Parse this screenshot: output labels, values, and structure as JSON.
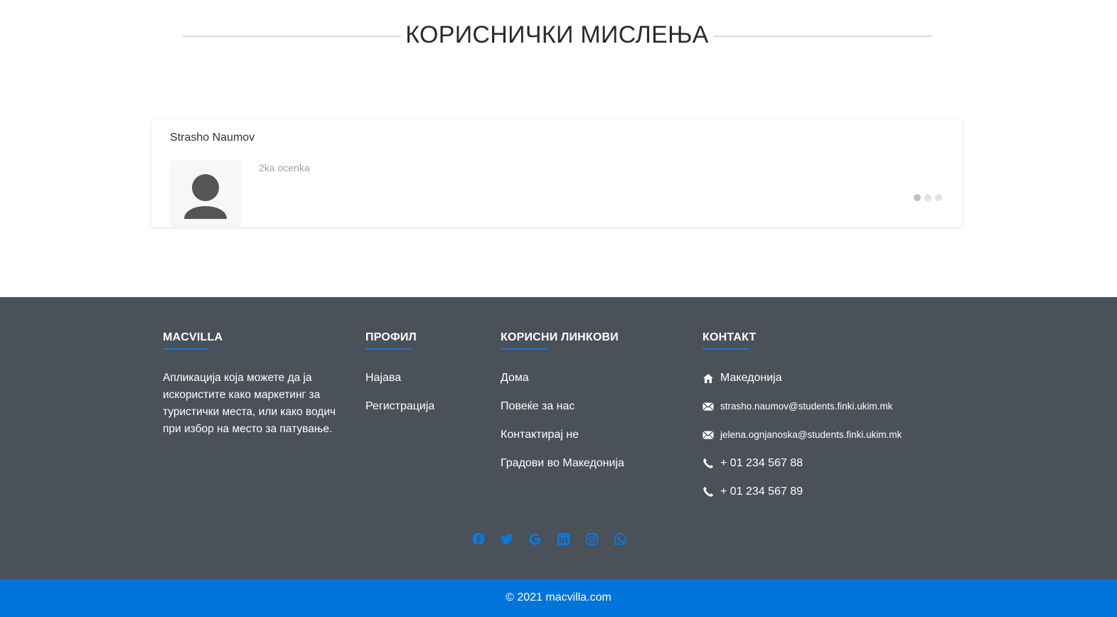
{
  "section": {
    "title": "КОРИСНИЧКИ МИСЛЕЊА"
  },
  "review": {
    "name": "Strasho Naumov",
    "text": "2ka ocenka",
    "dots": 3,
    "active_dot": 0
  },
  "footer": {
    "about": {
      "heading": "MACVILLA",
      "text": "Апликација која можете да ја искористите како маркетинг за туристички места, или како водич при избор на место за патување."
    },
    "profile": {
      "heading": "ПРОФИЛ",
      "links": [
        "Најава",
        "Регистрација"
      ]
    },
    "useful_links": {
      "heading": "КОРИСНИ ЛИНКОВИ",
      "links": [
        "Дома",
        "Повеќе за нас",
        "Контактирај не",
        "Градови во Македонија"
      ]
    },
    "contact": {
      "heading": "КОНТАКТ",
      "address": "Македонија",
      "email1": "strasho.naumov@students.finki.ukim.mk",
      "email2": "jelena.ognjanoska@students.finki.ukim.mk",
      "phone1": "+ 01 234 567 88",
      "phone2": "+ 01 234 567 89"
    },
    "social_icons": [
      "facebook-icon",
      "twitter-icon",
      "google-icon",
      "linkedin-icon",
      "instagram-icon",
      "whatsapp-icon"
    ],
    "social_color": "#0a7ae6",
    "copyright": "© 2021 macvilla.com"
  },
  "colors": {
    "footer_bg": "#4a5158",
    "copyright_bg": "#0074d9",
    "accent": "#1877e5"
  }
}
